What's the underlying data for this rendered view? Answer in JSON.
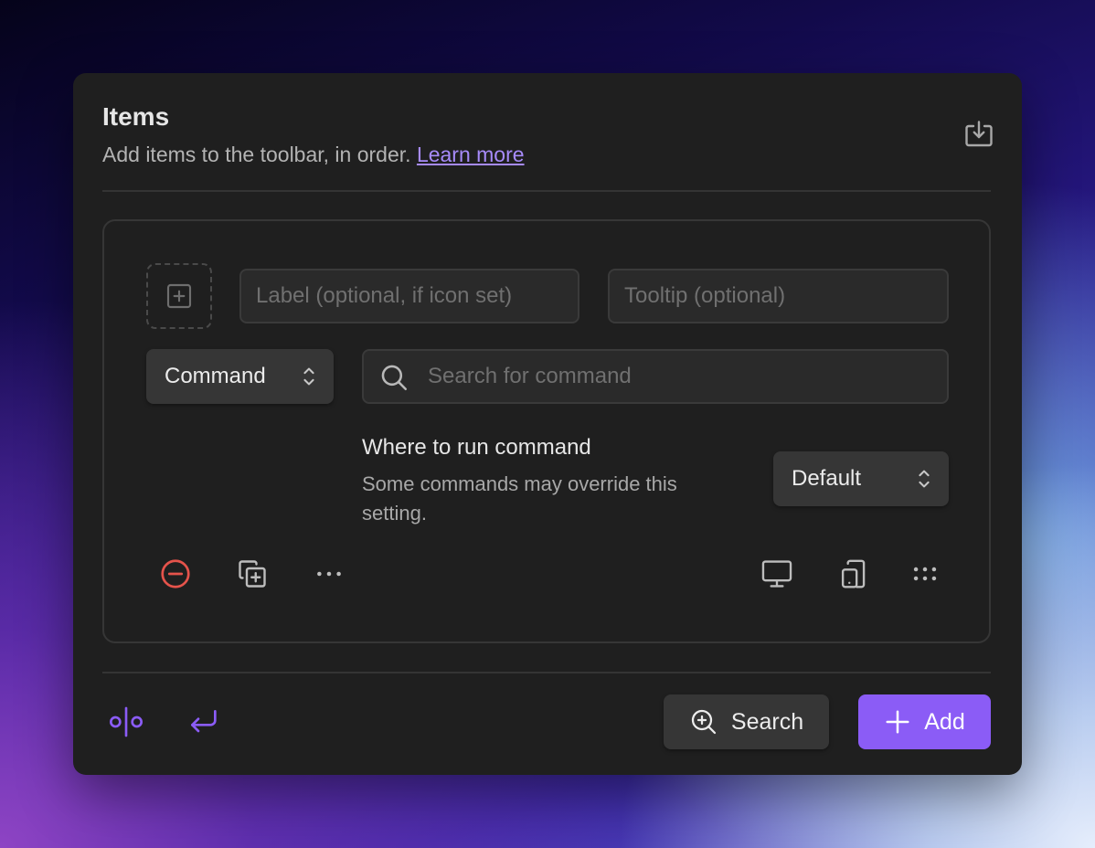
{
  "header": {
    "title": "Items",
    "subtitle": "Add items to the toolbar, in order.",
    "learn_more": "Learn more"
  },
  "item": {
    "label_placeholder": "Label (optional, if icon set)",
    "tooltip_placeholder": "Tooltip (optional)",
    "type_select": "Command",
    "command_search_placeholder": "Search for command",
    "run_setting_title": "Where to run command",
    "run_setting_desc": "Some commands may override this setting.",
    "run_select": "Default"
  },
  "footer": {
    "search_label": "Search",
    "add_label": "Add"
  },
  "colors": {
    "accent": "#8b5cf6",
    "link": "#a78bfa",
    "danger": "#e5534b"
  },
  "icons": {
    "export": "download-icon",
    "icon_picker": "plus-square-icon",
    "delete": "minus-circle-icon",
    "duplicate": "copy-plus-icon",
    "more": "more-horizontal-icon",
    "desktop": "monitor-icon",
    "mobile": "tablet-smartphone-icon",
    "drag": "grip-icon",
    "spacer": "separator-icon",
    "break": "corner-down-left-icon"
  }
}
